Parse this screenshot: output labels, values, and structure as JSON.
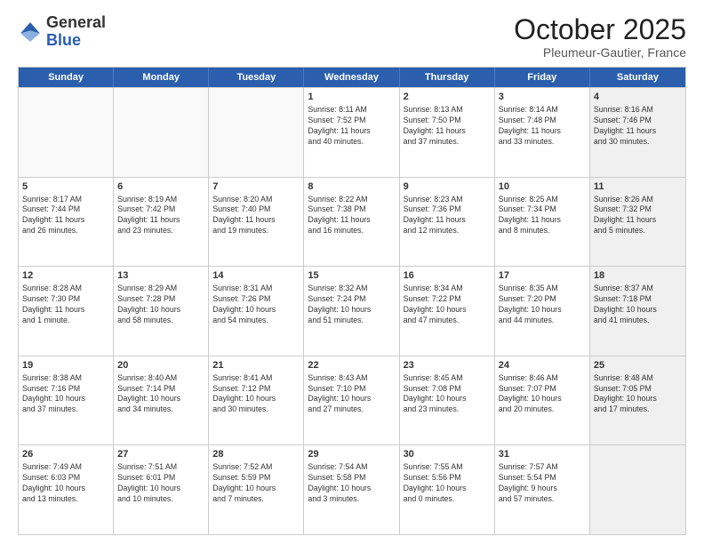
{
  "logo": {
    "general": "General",
    "blue": "Blue"
  },
  "header": {
    "month": "October 2025",
    "location": "Pleumeur-Gautier, France"
  },
  "weekdays": [
    "Sunday",
    "Monday",
    "Tuesday",
    "Wednesday",
    "Thursday",
    "Friday",
    "Saturday"
  ],
  "rows": [
    [
      {
        "day": "",
        "text": "",
        "empty": true
      },
      {
        "day": "",
        "text": "",
        "empty": true
      },
      {
        "day": "",
        "text": "",
        "empty": true
      },
      {
        "day": "1",
        "text": "Sunrise: 8:11 AM\nSunset: 7:52 PM\nDaylight: 11 hours\nand 40 minutes."
      },
      {
        "day": "2",
        "text": "Sunrise: 8:13 AM\nSunset: 7:50 PM\nDaylight: 11 hours\nand 37 minutes."
      },
      {
        "day": "3",
        "text": "Sunrise: 8:14 AM\nSunset: 7:48 PM\nDaylight: 11 hours\nand 33 minutes."
      },
      {
        "day": "4",
        "text": "Sunrise: 8:16 AM\nSunset: 7:46 PM\nDaylight: 11 hours\nand 30 minutes.",
        "shaded": true
      }
    ],
    [
      {
        "day": "5",
        "text": "Sunrise: 8:17 AM\nSunset: 7:44 PM\nDaylight: 11 hours\nand 26 minutes."
      },
      {
        "day": "6",
        "text": "Sunrise: 8:19 AM\nSunset: 7:42 PM\nDaylight: 11 hours\nand 23 minutes."
      },
      {
        "day": "7",
        "text": "Sunrise: 8:20 AM\nSunset: 7:40 PM\nDaylight: 11 hours\nand 19 minutes."
      },
      {
        "day": "8",
        "text": "Sunrise: 8:22 AM\nSunset: 7:38 PM\nDaylight: 11 hours\nand 16 minutes."
      },
      {
        "day": "9",
        "text": "Sunrise: 8:23 AM\nSunset: 7:36 PM\nDaylight: 11 hours\nand 12 minutes."
      },
      {
        "day": "10",
        "text": "Sunrise: 8:25 AM\nSunset: 7:34 PM\nDaylight: 11 hours\nand 8 minutes."
      },
      {
        "day": "11",
        "text": "Sunrise: 8:26 AM\nSunset: 7:32 PM\nDaylight: 11 hours\nand 5 minutes.",
        "shaded": true
      }
    ],
    [
      {
        "day": "12",
        "text": "Sunrise: 8:28 AM\nSunset: 7:30 PM\nDaylight: 11 hours\nand 1 minute."
      },
      {
        "day": "13",
        "text": "Sunrise: 8:29 AM\nSunset: 7:28 PM\nDaylight: 10 hours\nand 58 minutes."
      },
      {
        "day": "14",
        "text": "Sunrise: 8:31 AM\nSunset: 7:26 PM\nDaylight: 10 hours\nand 54 minutes."
      },
      {
        "day": "15",
        "text": "Sunrise: 8:32 AM\nSunset: 7:24 PM\nDaylight: 10 hours\nand 51 minutes."
      },
      {
        "day": "16",
        "text": "Sunrise: 8:34 AM\nSunset: 7:22 PM\nDaylight: 10 hours\nand 47 minutes."
      },
      {
        "day": "17",
        "text": "Sunrise: 8:35 AM\nSunset: 7:20 PM\nDaylight: 10 hours\nand 44 minutes."
      },
      {
        "day": "18",
        "text": "Sunrise: 8:37 AM\nSunset: 7:18 PM\nDaylight: 10 hours\nand 41 minutes.",
        "shaded": true
      }
    ],
    [
      {
        "day": "19",
        "text": "Sunrise: 8:38 AM\nSunset: 7:16 PM\nDaylight: 10 hours\nand 37 minutes."
      },
      {
        "day": "20",
        "text": "Sunrise: 8:40 AM\nSunset: 7:14 PM\nDaylight: 10 hours\nand 34 minutes."
      },
      {
        "day": "21",
        "text": "Sunrise: 8:41 AM\nSunset: 7:12 PM\nDaylight: 10 hours\nand 30 minutes."
      },
      {
        "day": "22",
        "text": "Sunrise: 8:43 AM\nSunset: 7:10 PM\nDaylight: 10 hours\nand 27 minutes."
      },
      {
        "day": "23",
        "text": "Sunrise: 8:45 AM\nSunset: 7:08 PM\nDaylight: 10 hours\nand 23 minutes."
      },
      {
        "day": "24",
        "text": "Sunrise: 8:46 AM\nSunset: 7:07 PM\nDaylight: 10 hours\nand 20 minutes."
      },
      {
        "day": "25",
        "text": "Sunrise: 8:48 AM\nSunset: 7:05 PM\nDaylight: 10 hours\nand 17 minutes.",
        "shaded": true
      }
    ],
    [
      {
        "day": "26",
        "text": "Sunrise: 7:49 AM\nSunset: 6:03 PM\nDaylight: 10 hours\nand 13 minutes."
      },
      {
        "day": "27",
        "text": "Sunrise: 7:51 AM\nSunset: 6:01 PM\nDaylight: 10 hours\nand 10 minutes."
      },
      {
        "day": "28",
        "text": "Sunrise: 7:52 AM\nSunset: 5:59 PM\nDaylight: 10 hours\nand 7 minutes."
      },
      {
        "day": "29",
        "text": "Sunrise: 7:54 AM\nSunset: 5:58 PM\nDaylight: 10 hours\nand 3 minutes."
      },
      {
        "day": "30",
        "text": "Sunrise: 7:55 AM\nSunset: 5:56 PM\nDaylight: 10 hours\nand 0 minutes."
      },
      {
        "day": "31",
        "text": "Sunrise: 7:57 AM\nSunset: 5:54 PM\nDaylight: 9 hours\nand 57 minutes."
      },
      {
        "day": "",
        "text": "",
        "empty": true,
        "shaded": true
      }
    ]
  ]
}
